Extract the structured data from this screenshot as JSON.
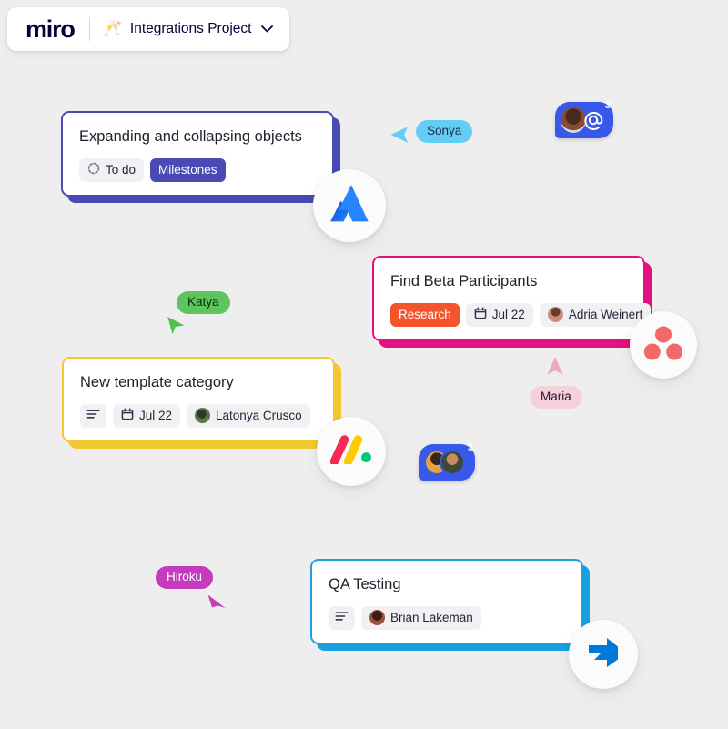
{
  "background_color": "#efeeee",
  "topbar": {
    "logo_text": "miro",
    "project_emoji": "🥂",
    "project_name": "Integrations Project",
    "dropdown_icon": "chevron-down-icon"
  },
  "cards": [
    {
      "id": "expanding-objects",
      "title": "Expanding and collapsing objects",
      "accent_color": "#4a4ab4",
      "chips": [
        {
          "type": "status",
          "icon": "dotted-circle-icon",
          "label": "To do",
          "bg": "#f1f1f3",
          "fg": "#262638"
        },
        {
          "type": "tag",
          "label": "Milestones",
          "bg": "#4a4ab4",
          "fg": "#ffffff"
        }
      ]
    },
    {
      "id": "find-beta-participants",
      "title": "Find Beta Participants",
      "accent_color": "#e5107f",
      "chips": [
        {
          "type": "tag",
          "label": "Research",
          "bg": "#f2552c",
          "fg": "#ffffff"
        },
        {
          "type": "date",
          "icon": "calendar-icon",
          "label": "Jul 22",
          "bg": "#f1f1f3",
          "fg": "#262638"
        },
        {
          "type": "assignee",
          "icon": "avatar",
          "label": "Adria Weinert",
          "bg": "#f1f1f3",
          "fg": "#262638",
          "avatar_colors": [
            "#c98f78",
            "#6e3a28"
          ]
        }
      ]
    },
    {
      "id": "new-template-category",
      "title": "New template category",
      "accent_color": "#f2c832",
      "chips": [
        {
          "type": "description",
          "icon": "description-lines-icon",
          "label": "",
          "bg": "#f1f1f3",
          "fg": "#262638"
        },
        {
          "type": "date",
          "icon": "calendar-icon",
          "label": "Jul 22",
          "bg": "#f1f1f3",
          "fg": "#262638"
        },
        {
          "type": "assignee",
          "icon": "avatar",
          "label": "Latonya Crusco",
          "bg": "#f1f1f3",
          "fg": "#262638",
          "avatar_colors": [
            "#5b7a4a",
            "#2d3b24"
          ]
        }
      ]
    },
    {
      "id": "qa-testing",
      "title": "QA Testing",
      "accent_color": "#18a0e0",
      "chips": [
        {
          "type": "description",
          "icon": "description-lines-icon",
          "label": "",
          "bg": "#f1f1f3",
          "fg": "#262638"
        },
        {
          "type": "assignee",
          "icon": "avatar",
          "label": "Brian Lakeman",
          "bg": "#f1f1f3",
          "fg": "#262638",
          "avatar_colors": [
            "#a0503a",
            "#3a1e16"
          ]
        }
      ]
    }
  ],
  "cursors": [
    {
      "id": "sonya",
      "name": "Sonya",
      "pill_bg": "#63cdf6",
      "pill_fg": "#1c2b4a",
      "arrow_color": "#63cdf6",
      "direction": "left"
    },
    {
      "id": "katya",
      "name": "Katya",
      "pill_bg": "#5ec45e",
      "pill_fg": "#102a10",
      "arrow_color": "#4fc04f",
      "direction": "right-down"
    },
    {
      "id": "maria",
      "name": "Maria",
      "pill_bg": "#f6d0da",
      "pill_fg": "#2a1430",
      "arrow_color": "#f0a8bc",
      "direction": "up"
    },
    {
      "id": "hiroku",
      "name": "Hiroku",
      "pill_bg": "#c63bbd",
      "pill_fg": "#ffffff",
      "arrow_color": "#c63bbd",
      "direction": "left-down"
    }
  ],
  "app_logos": [
    {
      "id": "atlassian",
      "name": "atlassian-logo-icon",
      "color": "#2684ff"
    },
    {
      "id": "asana",
      "name": "asana-logo-icon",
      "color": "#f06a6a"
    },
    {
      "id": "monday",
      "name": "monday-logo-icon",
      "color": "#ffcb00"
    },
    {
      "id": "azuredevops",
      "name": "azure-devops-logo-icon",
      "color": "#0078d7"
    }
  ],
  "presence_bubbles": [
    {
      "id": "mention-bubble",
      "count": "3",
      "icon": "at-mention-icon",
      "avatars": 1,
      "bg": "#3858e9"
    },
    {
      "id": "collaborators-bubble",
      "count": "3",
      "icon": "avatar-stack",
      "avatars": 2,
      "bg": "#3858e9"
    }
  ]
}
